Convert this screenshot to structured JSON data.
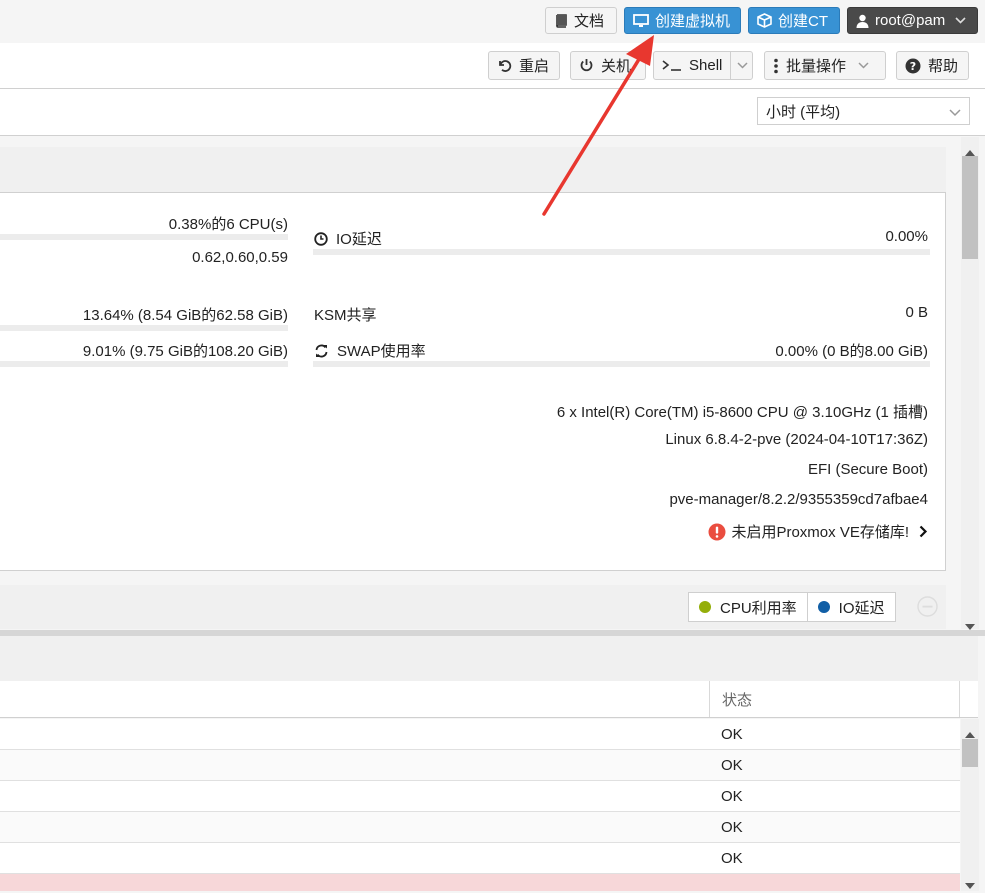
{
  "header": {
    "docs_label": "文档",
    "create_vm_label": "创建虚拟机",
    "create_ct_label": "创建CT",
    "user_label": "root@pam"
  },
  "toolbar": {
    "reboot_label": "重启",
    "shutdown_label": "关机",
    "shell_label": "Shell",
    "bulk_label": "批量操作",
    "help_label": "帮助"
  },
  "range": {
    "selected": "小时 (平均)"
  },
  "summary": {
    "cpu_value": "0.38%的6 CPU(s)",
    "load_value": "0.62,0.60,0.59",
    "mem_value": "13.64% (8.54 GiB的62.58 GiB)",
    "root_value": "9.01% (9.75 GiB的108.20 GiB)",
    "io_label": "IO延迟",
    "io_value": "0.00%",
    "ksm_label": "KSM共享",
    "ksm_value": "0 B",
    "swap_label": "SWAP使用率",
    "swap_value": "0.00% (0 B的8.00 GiB)",
    "cpu_model": "6 x Intel(R) Core(TM) i5-8600 CPU @ 3.10GHz (1 插槽)",
    "kernel": "Linux 6.8.4-2-pve (2024-04-10T17:36Z)",
    "boot_mode": "EFI (Secure Boot)",
    "manager": "pve-manager/8.2.2/9355359cd7afbae4",
    "repo_warning": "未启用Proxmox VE存储库!"
  },
  "chart_legend": {
    "cpu_label": "CPU利用率",
    "io_label": "IO延迟",
    "cpu_color": "#94ae0a",
    "io_color": "#115fa6"
  },
  "table": {
    "status_header": "状态",
    "rows": [
      {
        "status": "OK"
      },
      {
        "status": "OK"
      },
      {
        "status": "OK"
      },
      {
        "status": "OK"
      },
      {
        "status": "OK"
      }
    ]
  },
  "colors": {
    "accent": "#3892d4",
    "annotation_arrow": "#e8372f",
    "warning": "#ea4d3f"
  }
}
